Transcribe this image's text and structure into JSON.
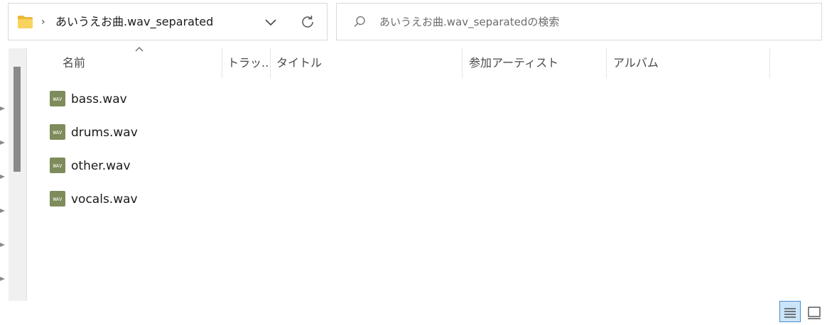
{
  "address_bar": {
    "path": "あいうえお曲.wav_separated",
    "chevron": "›"
  },
  "search": {
    "placeholder": "あいうえお曲.wav_separatedの検索"
  },
  "columns": [
    {
      "label": "名前"
    },
    {
      "label": "トラッ..."
    },
    {
      "label": "タイトル"
    },
    {
      "label": "参加アーティスト"
    },
    {
      "label": "アルバム"
    }
  ],
  "sort": {
    "column": "名前",
    "direction": "ascending"
  },
  "files": [
    {
      "name": "bass.wav",
      "icon": "wav-file-icon"
    },
    {
      "name": "drums.wav",
      "icon": "wav-file-icon"
    },
    {
      "name": "other.wav",
      "icon": "wav-file-icon"
    },
    {
      "name": "vocals.wav",
      "icon": "wav-file-icon"
    }
  ],
  "icon_label": "WAV",
  "view": {
    "active": "details"
  },
  "colors": {
    "folder": "#f5c542",
    "wav_icon": "#7d8c5a",
    "view_active_bg": "#cce4f7",
    "view_active_border": "#4a8fd0"
  }
}
